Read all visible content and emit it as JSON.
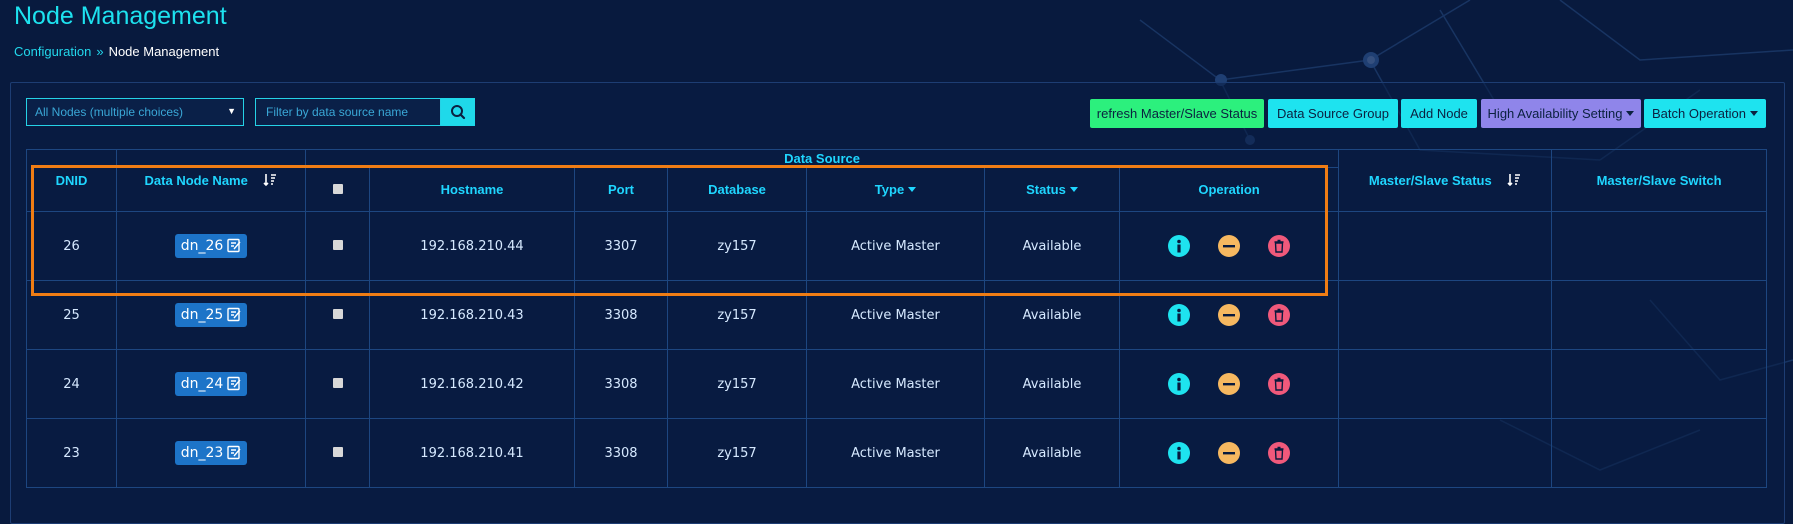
{
  "page": {
    "title": "Node Management",
    "breadcrumb": {
      "parent": "Configuration",
      "separator": "»",
      "current": "Node Management"
    }
  },
  "filters": {
    "node_select_value": "All Nodes (multiple choices)",
    "search_placeholder": "Filter by data source name"
  },
  "toolbar": {
    "refresh_label": "refresh Master/Slave Status",
    "group_label": "Data Source Group",
    "add_label": "Add Node",
    "ha_label": "High Availability Setting",
    "batch_label": "Batch Operation"
  },
  "table": {
    "headers": {
      "dnid": "DNID",
      "node_name": "Data Node Name",
      "data_source": "Data Source",
      "hostname": "Hostname",
      "port": "Port",
      "database": "Database",
      "type": "Type",
      "status": "Status",
      "operation": "Operation",
      "ms_status": "Master/Slave Status",
      "ms_switch": "Master/Slave Switch"
    },
    "rows": [
      {
        "dnid": "26",
        "name": "dn_26",
        "hostname": "192.168.210.44",
        "port": "3307",
        "database": "zy157",
        "type": "Active Master",
        "status": "Available"
      },
      {
        "dnid": "25",
        "name": "dn_25",
        "hostname": "192.168.210.43",
        "port": "3308",
        "database": "zy157",
        "type": "Active Master",
        "status": "Available"
      },
      {
        "dnid": "24",
        "name": "dn_24",
        "hostname": "192.168.210.42",
        "port": "3308",
        "database": "zy157",
        "type": "Active Master",
        "status": "Available"
      },
      {
        "dnid": "23",
        "name": "dn_23",
        "hostname": "192.168.210.41",
        "port": "3308",
        "database": "zy157",
        "type": "Active Master",
        "status": "Available"
      }
    ]
  },
  "colors": {
    "background": "#081a3e",
    "accent": "#1de2ef",
    "available": "#2cf07d",
    "highlight": "#f07d14",
    "delete": "#f0597b",
    "minus": "#f6b860"
  }
}
